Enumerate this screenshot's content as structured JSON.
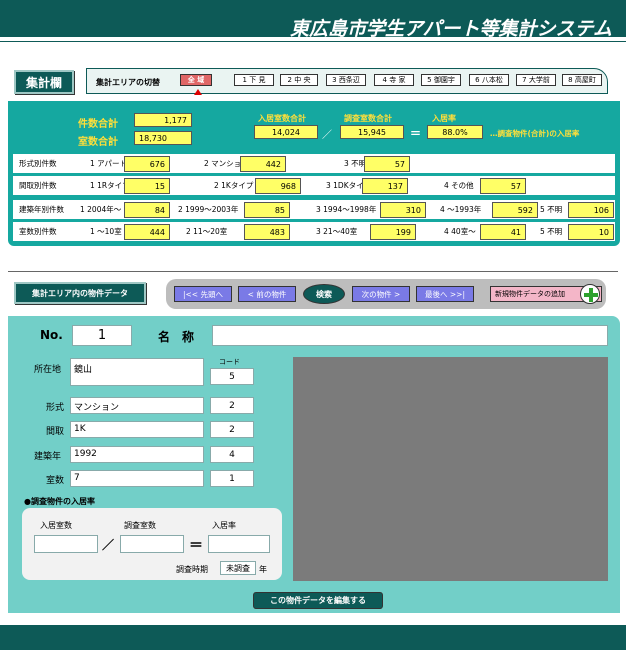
{
  "header": {
    "title": "東広島市学生アパート等集計システム"
  },
  "summary": {
    "section_label": "集計欄",
    "area_label": "集計エリアの切替",
    "area_buttons": [
      "全 域",
      "1 下 見",
      "2 中 央",
      "3 西条辺",
      "4 寺 家",
      "5 御園宇",
      "6 八本松",
      "7 大学前",
      "8 高屋町"
    ],
    "total_count_label": "件数合計",
    "total_count_value": "1,177",
    "total_rooms_label": "室数合計",
    "total_rooms_value": "18,730",
    "occupied_label": "入居室数合計",
    "occupied_value": "14,024",
    "surveyed_label": "調査室数合計",
    "surveyed_value": "15,945",
    "rate_label": "入居率",
    "rate_value": "88.0%",
    "slash": "／",
    "equals": "＝",
    "rate_note": "…調査物件(合計)の入居率",
    "rows": [
      {
        "label": "形式別件数",
        "items": [
          {
            "t": "1 アパート",
            "v": "676"
          },
          {
            "t": "2 マンション",
            "v": "442"
          },
          {
            "t": "3 不明",
            "v": "57"
          }
        ]
      },
      {
        "label": "間取別件数",
        "items": [
          {
            "t": "1 1Rタイプ",
            "v": "15"
          },
          {
            "t": "2 1Kタイプ",
            "v": "968"
          },
          {
            "t": "3 1DKタイプ",
            "v": "137"
          },
          {
            "t": "4 その他",
            "v": "57"
          }
        ]
      },
      {
        "label": "建築年別件数",
        "items": [
          {
            "t": "1 2004年～",
            "v": "84"
          },
          {
            "t": "2 1999～2003年",
            "v": "85"
          },
          {
            "t": "3 1994～1998年",
            "v": "310"
          },
          {
            "t": "4 ～1993年",
            "v": "592"
          },
          {
            "t": "5 不明",
            "v": "106"
          }
        ]
      },
      {
        "label": "室数別件数",
        "items": [
          {
            "t": "1 ～10室",
            "v": "444"
          },
          {
            "t": "2 11～20室",
            "v": "483"
          },
          {
            "t": "3 21～40室",
            "v": "199"
          },
          {
            "t": "4 40室～",
            "v": "41"
          },
          {
            "t": "5 不明",
            "v": "10"
          }
        ]
      }
    ]
  },
  "nav": {
    "section_label": "集計エリア内の物件データ",
    "first": "|<< 先頭へ",
    "prev": "< 前の物件",
    "search": "検索",
    "next": "次の物件 >",
    "last": "最後へ >>|",
    "add": "新規物件データの追加",
    "add_icon": "plus-icon"
  },
  "record": {
    "no_label": "No.",
    "no_value": "1",
    "name_label": "名　称",
    "name_value": "",
    "address_label": "所在地",
    "address_value": "鏡山",
    "code_label": "コード",
    "code_value": "5",
    "type_label": "形式",
    "type_value": "マンション",
    "type_code": "2",
    "layout_label": "間取",
    "layout_value": "1K",
    "layout_code": "2",
    "year_label": "建築年",
    "year_value": "1992",
    "year_code": "4",
    "rooms_label": "室数",
    "rooms_value": "7",
    "rooms_code": "1",
    "occ_heading": "●調査物件の入居率",
    "occ_rooms_label": "入居室数",
    "occ_survey_label": "調査室数",
    "occ_rate_label": "入居率",
    "occ_rooms_value": "",
    "occ_survey_value": "",
    "occ_rate_value": "",
    "period_label": "調査時期",
    "period_value": "未調査",
    "period_unit": "年",
    "edit_button": "この物件データを編集する"
  },
  "colors": {
    "dark_teal": "#0d5a57",
    "teal": "#15a8a0",
    "panel": "#72cfc8",
    "yellow": "#ffff66",
    "selected": "#e06666",
    "nav_btn": "#7a7ae6"
  }
}
